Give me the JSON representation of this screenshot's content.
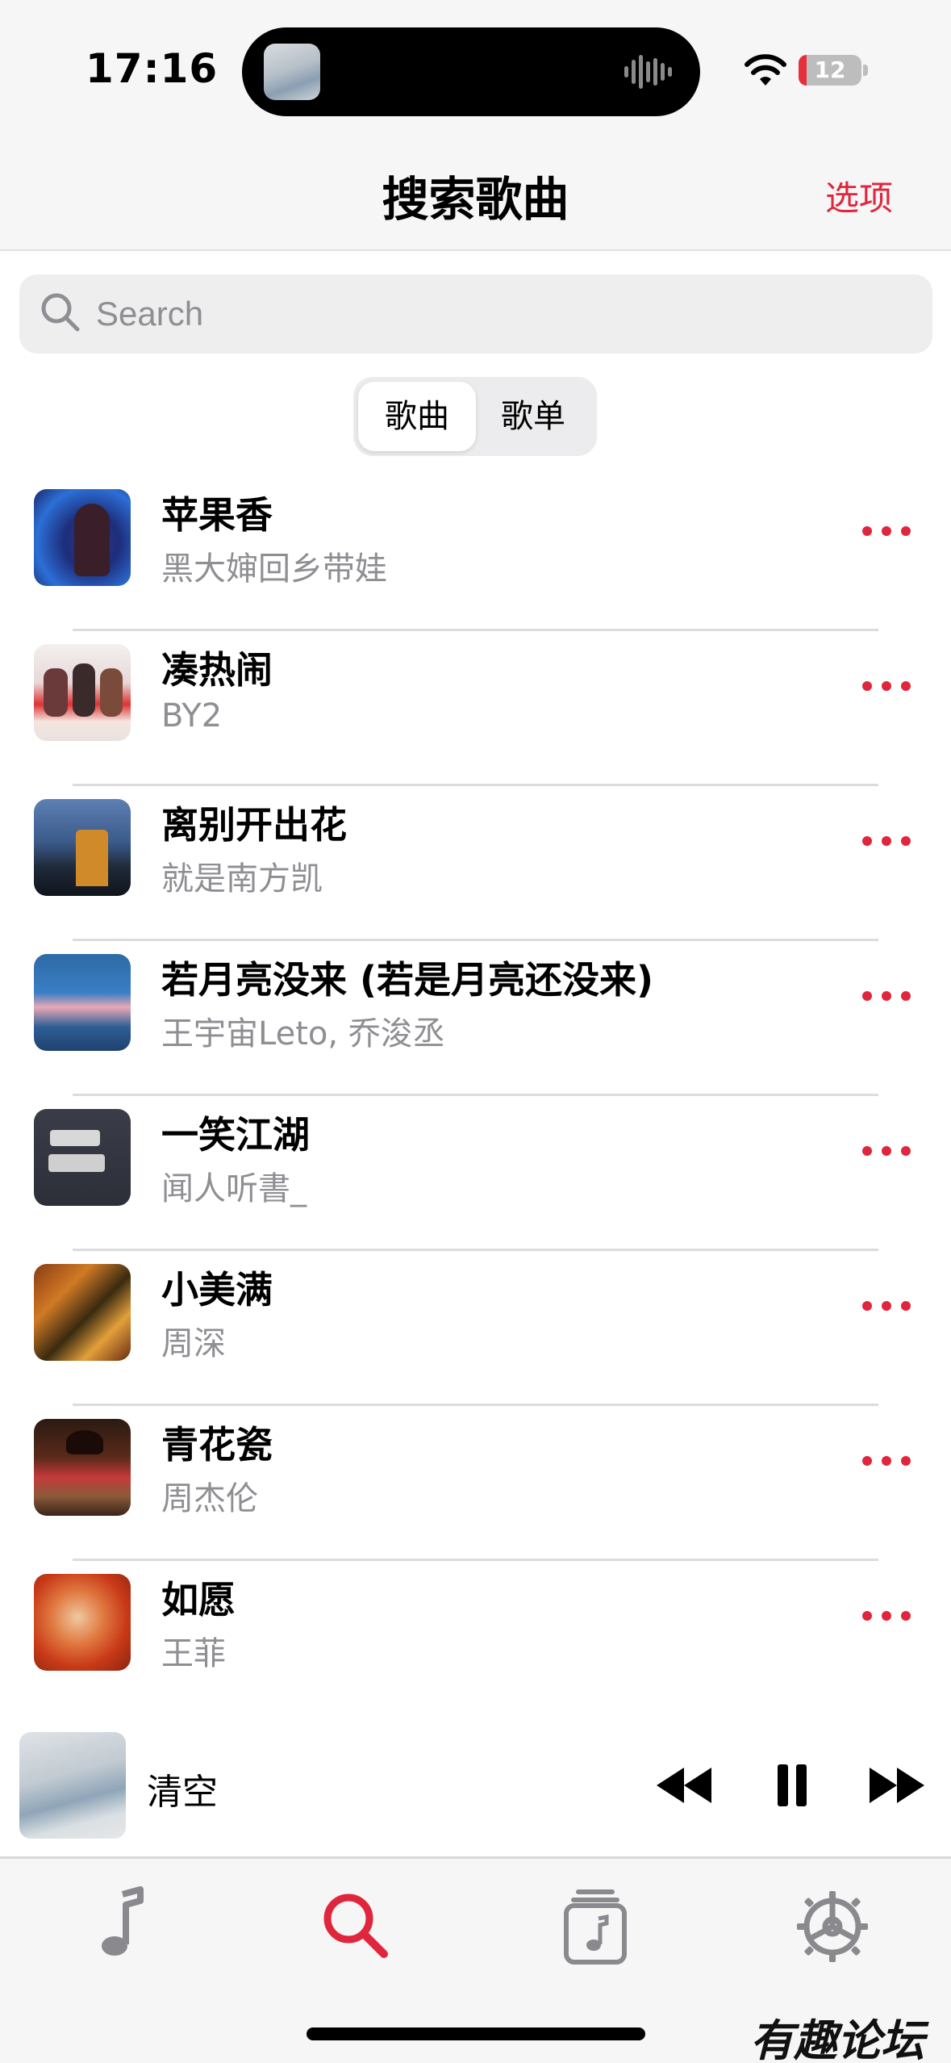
{
  "status_bar": {
    "time": "17:16",
    "battery": "12"
  },
  "header": {
    "title": "搜索歌曲",
    "options_label": "选项"
  },
  "search": {
    "placeholder": "Search"
  },
  "segmented": {
    "songs_label": "歌曲",
    "playlists_label": "歌单",
    "selected": "歌曲"
  },
  "songs": [
    {
      "title": "苹果香",
      "artist": "黑大婶回乡带娃"
    },
    {
      "title": "凑热闹",
      "artist": "BY2"
    },
    {
      "title": "离别开出花",
      "artist": "就是南方凯"
    },
    {
      "title": "若月亮没来 (若是月亮还没来)",
      "artist": "王宇宙Leto, 乔浚丞"
    },
    {
      "title": "一笑江湖",
      "artist": "闻人听書_"
    },
    {
      "title": "小美满",
      "artist": "周深"
    },
    {
      "title": "青花瓷",
      "artist": "周杰伦"
    },
    {
      "title": "如愿",
      "artist": "王菲"
    }
  ],
  "now_playing": {
    "title": "清空"
  },
  "tabs": [
    {
      "icon": "music-note-icon",
      "active": false
    },
    {
      "icon": "search-icon",
      "active": true
    },
    {
      "icon": "playlist-icon",
      "active": false
    },
    {
      "icon": "settings-icon",
      "active": false
    }
  ],
  "watermark": "有趣论坛",
  "colors": {
    "accent": "#e0263c",
    "secondary_text": "#8e8e93",
    "tab_inactive": "#8a8a8e"
  }
}
